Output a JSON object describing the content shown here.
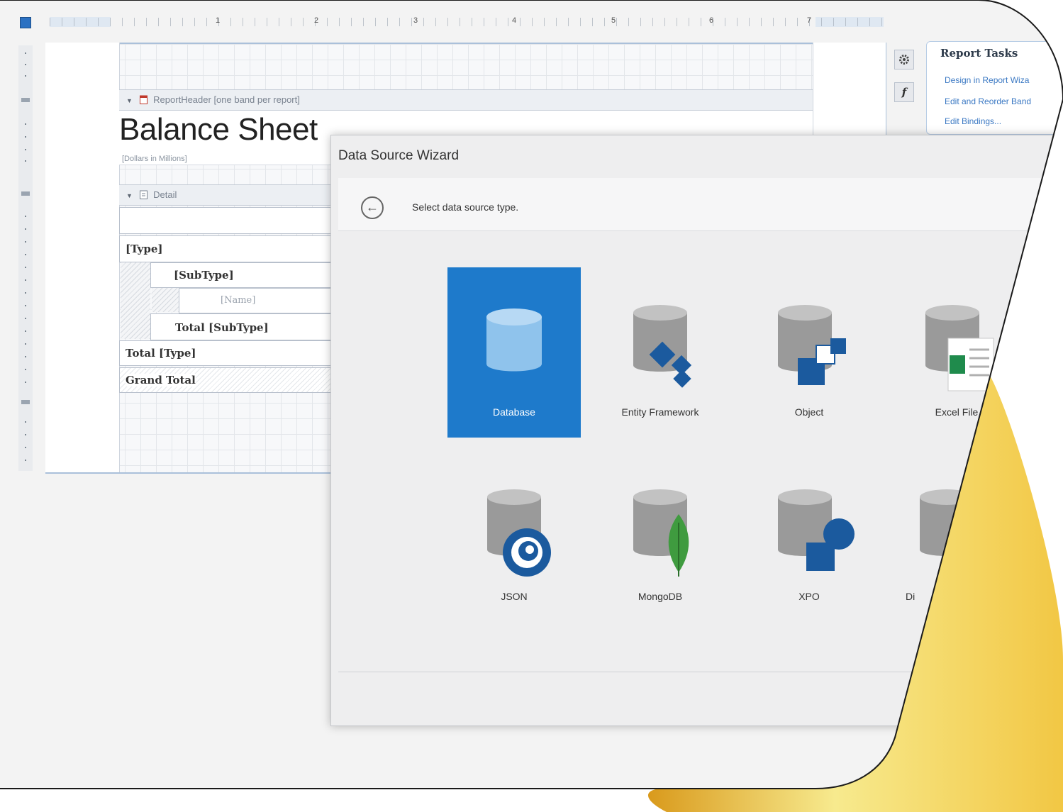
{
  "ruler": {
    "numbers": [
      "1",
      "2",
      "3",
      "4",
      "5",
      "6",
      "7"
    ]
  },
  "report": {
    "header_band": "ReportHeader [one band per report]",
    "title": "Balance Sheet",
    "subtitle": "[Dollars in Millions]",
    "detail_band": "Detail",
    "rows": {
      "type": "[Type]",
      "subtype": "[SubType]",
      "name": "[Name]",
      "total_subtype": "Total [SubType]",
      "total_type": "Total [Type]",
      "grand_total": "Grand Total"
    }
  },
  "tasks": {
    "title": "Report Tasks",
    "links": [
      "Design in Report Wiza",
      "Edit and Reorder Band",
      "Edit Bindings..."
    ],
    "gear_icon": "gear-icon",
    "fx_label": "f"
  },
  "wizard": {
    "title": "Data Source Wizard",
    "step": "Select data source type.",
    "tiles": [
      {
        "label": "Database",
        "icon": "database-icon",
        "selected": true
      },
      {
        "label": "Entity Framework",
        "icon": "entity-framework-icon",
        "selected": false
      },
      {
        "label": "Object",
        "icon": "object-icon",
        "selected": false
      },
      {
        "label": "Excel File",
        "icon": "excel-icon",
        "selected": false
      },
      {
        "label": "JSON",
        "icon": "json-icon",
        "selected": false
      },
      {
        "label": "MongoDB",
        "icon": "mongodb-icon",
        "selected": false
      },
      {
        "label": "XPO",
        "icon": "xpo-icon",
        "selected": false
      },
      {
        "label": "Di",
        "icon": "federation-icon",
        "selected": false
      }
    ]
  },
  "colors": {
    "accent": "#1e7acb",
    "link": "#3a78c3",
    "gold": "#f2c744",
    "frame": "#1a1a1a"
  }
}
